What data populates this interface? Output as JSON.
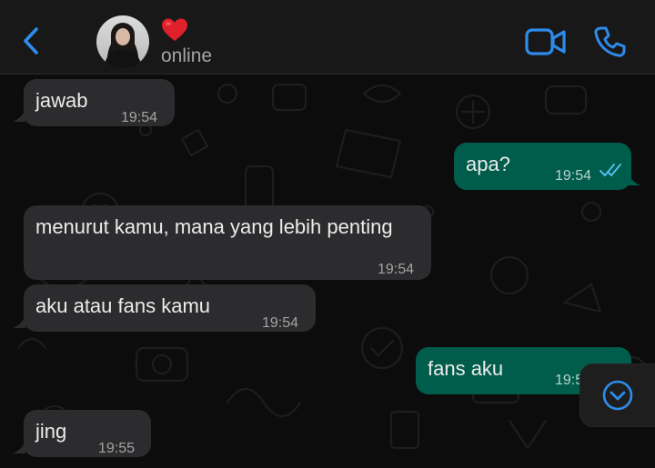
{
  "header": {
    "status": "online"
  },
  "messages": [
    {
      "direction": "incoming",
      "text": "jawab",
      "time": "19:54"
    },
    {
      "direction": "outgoing",
      "text": "apa?",
      "time": "19:54",
      "read": true
    },
    {
      "direction": "incoming",
      "text": "menurut kamu, mana yang lebih penting",
      "time": "19:54"
    },
    {
      "direction": "incoming",
      "text": "aku atau fans kamu",
      "time": "19:54"
    },
    {
      "direction": "outgoing",
      "text": "fans aku",
      "time": "19:5"
    },
    {
      "direction": "incoming",
      "text": "jing",
      "time": "19:55"
    }
  ],
  "colors": {
    "accent": "#2d8ceb",
    "incoming_bubble": "#2c2c2e",
    "outgoing_bubble": "#005c4b",
    "read_ticks": "#53bdeb",
    "heart": "#e0202a"
  },
  "icons": {
    "back": "chevron-left-icon",
    "video": "video-camera-icon",
    "call": "phone-icon",
    "scroll": "chevron-down-circle-icon",
    "read": "double-check-icon"
  }
}
